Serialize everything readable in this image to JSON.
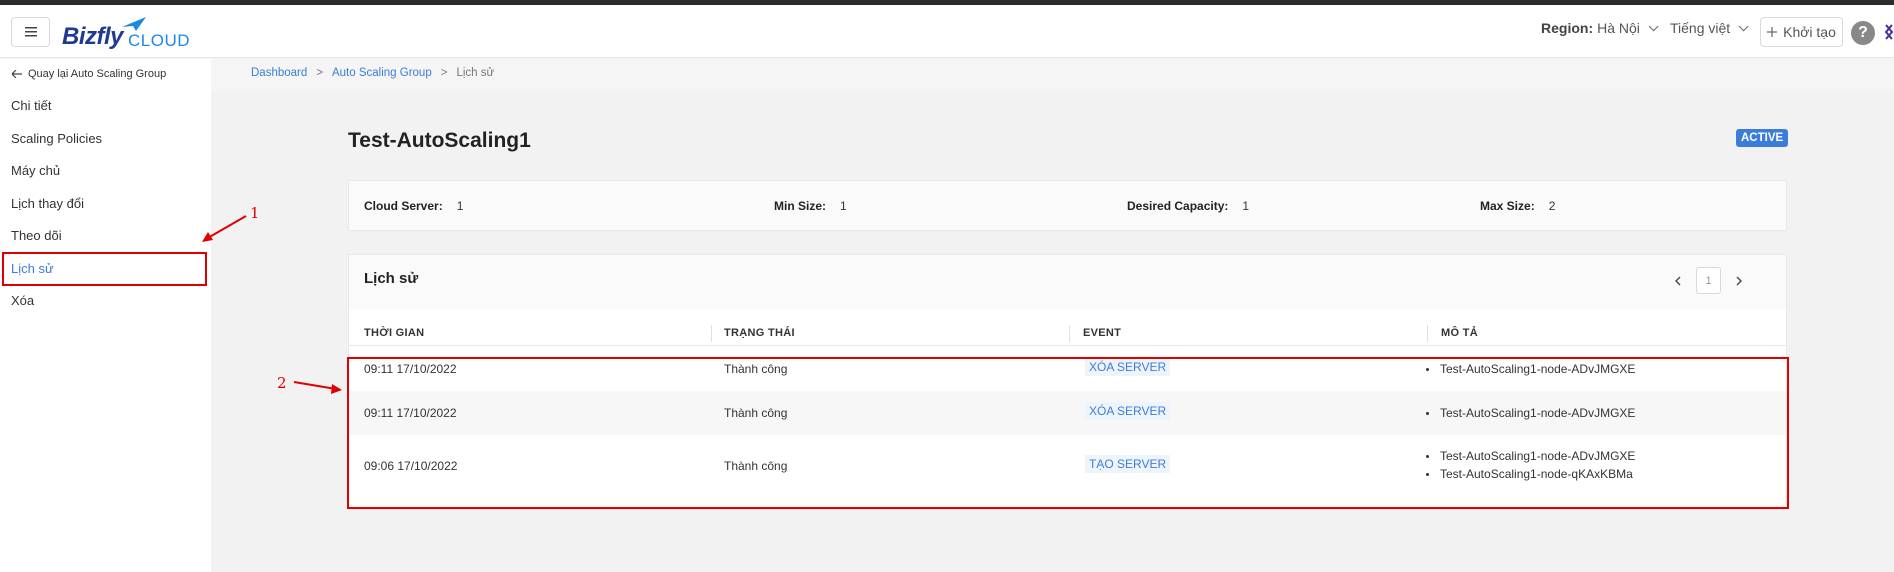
{
  "header": {
    "menu_icon": "hamburger-icon",
    "logo_primary": "Bizfly",
    "logo_secondary": "CLOUD",
    "region_label": "Region:",
    "region_value": "Hà Nội",
    "language": "Tiếng việt",
    "create_label": "Khởi tạo",
    "help_label": "?"
  },
  "sidebar": {
    "back_label": "Quay lại Auto Scaling Group",
    "items": [
      {
        "label": "Chi tiết"
      },
      {
        "label": "Scaling Policies"
      },
      {
        "label": "Máy chủ"
      },
      {
        "label": "Lịch thay đổi"
      },
      {
        "label": "Theo dõi"
      },
      {
        "label": "Lịch sử",
        "active": true
      },
      {
        "label": "Xóa"
      }
    ]
  },
  "breadcrumb": [
    "Dashboard",
    "Auto Scaling Group",
    "Lịch sử"
  ],
  "page": {
    "title": "Test-AutoScaling1",
    "status": "ACTIVE"
  },
  "info": {
    "cloud_server_label": "Cloud Server:",
    "cloud_server_value": "1",
    "min_size_label": "Min Size:",
    "min_size_value": "1",
    "desired_label": "Desired Capacity:",
    "desired_value": "1",
    "max_size_label": "Max Size:",
    "max_size_value": "2"
  },
  "history": {
    "title": "Lịch sử",
    "page": "1",
    "columns": [
      "THỜI GIAN",
      "TRẠNG THÁI",
      "EVENT",
      "MÔ TẢ"
    ],
    "rows": [
      {
        "time": "09:11 17/10/2022",
        "status": "Thành công",
        "event": "XÓA SERVER",
        "desc": [
          "Test-AutoScaling1-node-ADvJMGXE"
        ]
      },
      {
        "time": "09:11 17/10/2022",
        "status": "Thành công",
        "event": "XÓA SERVER",
        "desc": [
          "Test-AutoScaling1-node-ADvJMGXE"
        ]
      },
      {
        "time": "09:06 17/10/2022",
        "status": "Thành công",
        "event": "TẠO SERVER",
        "desc": [
          "Test-AutoScaling1-node-ADvJMGXE",
          "Test-AutoScaling1-node-qKAxKBMa"
        ]
      }
    ]
  },
  "annotations": {
    "label_1": "1",
    "label_2": "2",
    "color": "#e00000"
  },
  "colors": {
    "accent": "#3b7dd8",
    "brand_dark": "#1f3a93",
    "brand_light": "#1e88e5"
  }
}
